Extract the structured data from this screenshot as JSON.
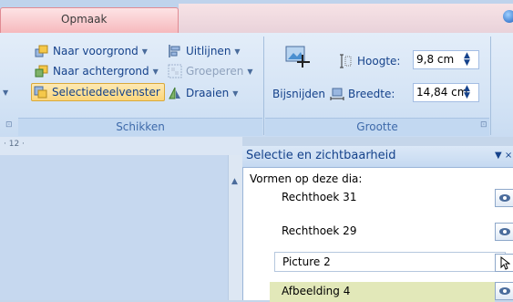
{
  "ribbon": {
    "tab_active": "Opmaak",
    "arrange_group": {
      "label": "Schikken",
      "bring_forward": "Naar voorgrond",
      "send_backward": "Naar achtergrond",
      "selection_pane": "Selectiedeelvenster",
      "align": "Uitlijnen",
      "group": "Groeperen",
      "rotate": "Draaien"
    },
    "size_group": {
      "label": "Grootte",
      "crop": "Bijsnijden",
      "height_label": "Hoogte:",
      "height_value": "9,8 cm",
      "width_label": "Breedte:",
      "width_value": "14,84 cm"
    }
  },
  "ruler": {
    "mark": "· 12 ·"
  },
  "selection_pane": {
    "title": "Selectie en zichtbaarheid",
    "subtitle": "Vormen op deze dia:",
    "items": [
      {
        "label": "Rechthoek 31"
      },
      {
        "label": "Rechthoek 29"
      },
      {
        "label": "Picture 2"
      },
      {
        "label": "Afbeelding 4"
      }
    ]
  }
}
